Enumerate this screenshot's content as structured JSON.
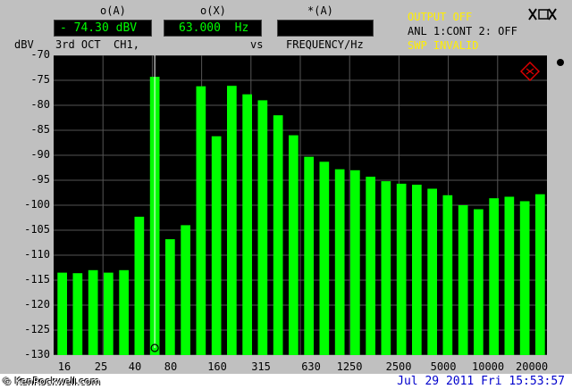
{
  "header": {
    "col1_label": "o(A)",
    "col2_label": "o(X)",
    "col3_label": "*(A)",
    "readout_a": "- 74.30 dBV",
    "readout_x": "63.000  Hz",
    "readout_star": "",
    "unit_left": "dBV",
    "trace_label": "3rd OCT  CH1,",
    "vs_label": "vs",
    "x_unit": "FREQUENCY/Hz"
  },
  "status": {
    "line1": "OUTPUT OFF",
    "line2": "ANL 1:CONT 2: OFF",
    "line3": "SWP INVALID",
    "warn_color": "#ffee00"
  },
  "footer": {
    "watermark": "© KenRockwell.com",
    "datetime": "Jul 29 2011 Fri 15:53:57"
  },
  "colors": {
    "plot_bg": "#000000",
    "bar": "#00ff00",
    "readout_text": "#00ff00",
    "grid": "#555555"
  },
  "chart_data": {
    "type": "bar",
    "ylabel": "dBV",
    "xlabel": "FREQUENCY/Hz",
    "ylim": [
      -130,
      -70
    ],
    "yticks": [
      -70,
      -75,
      -80,
      -85,
      -90,
      -95,
      -100,
      -105,
      -110,
      -115,
      -120,
      -125,
      -130
    ],
    "xtick_labels": [
      "16",
      "25",
      "40",
      "80",
      "160",
      "315",
      "630",
      "1250",
      "2500",
      "5000",
      "10000",
      "20000"
    ],
    "grid": true,
    "values": [
      -113.5,
      -113.6,
      -113.0,
      -113.5,
      -113.0,
      -102.3,
      -74.3,
      -106.8,
      -104.0,
      -76.2,
      -86.2,
      -76.1,
      -77.8,
      -79.0,
      -82.0,
      -86.0,
      -90.3,
      -91.3,
      -92.8,
      -93.0,
      -94.3,
      -95.2,
      -95.7,
      -95.9,
      -96.7,
      -98.0,
      -100.0,
      -100.8,
      -98.6,
      -98.3,
      -99.2,
      -97.8
    ],
    "cursor_bar_index": 6,
    "cursor_value": -74.3
  }
}
